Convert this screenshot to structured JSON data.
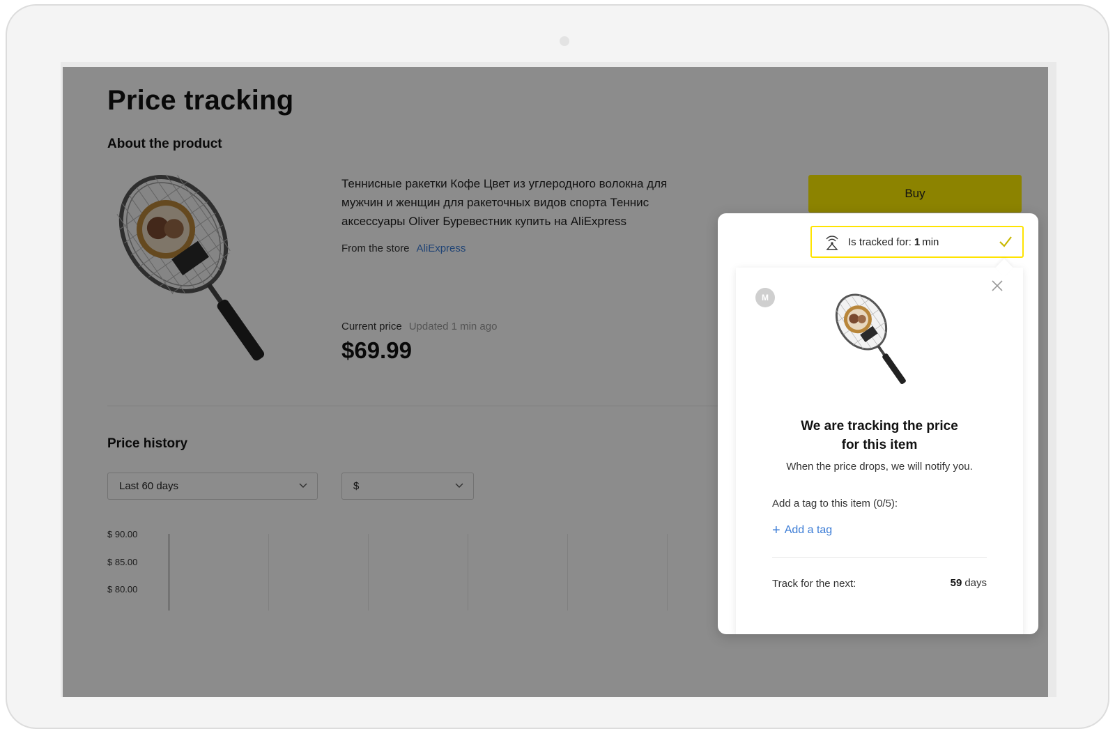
{
  "page": {
    "title": "Price tracking",
    "about_title": "About the product",
    "product_name": "Теннисные ракетки Кофе Цвет из углеродного волокна для мужчин и женщин для ракеточных видов спорта Теннис аксессуары Oliver Буревестник купить на AliExpress",
    "store_label": "From the store",
    "store_name": "AliExpress",
    "current_price_label": "Current price",
    "updated_text": "Updated 1 min ago",
    "current_price": "$69.99",
    "buy_label": "Buy",
    "price_history_title": "Price history",
    "period_select": "Last 60 days",
    "currency_select": "$",
    "y_ticks": [
      "$ 90.00",
      "$ 85.00",
      "$ 80.00"
    ]
  },
  "popup": {
    "tracked_prefix": "Is tracked for:",
    "tracked_value": "1",
    "tracked_unit": "min",
    "avatar_letter": "M",
    "title": "We are tracking the price for this item",
    "subtitle": "When the price drops, we will notify you.",
    "tag_label": "Add a tag to this item (0/5):",
    "add_tag_label": "Add a tag",
    "add_tag_symbol": "+",
    "track_label": "Track for the next:",
    "track_days_value": "59",
    "track_days_unit": "days"
  },
  "colors": {
    "accent_yellow": "#ffee00",
    "link_blue": "#3a7bd5",
    "overlay": "rgba(0,0,0,0.45)"
  },
  "icons": {
    "radar": "radar-icon",
    "check": "check-icon",
    "close": "close-icon",
    "chevron": "chevron-down-icon",
    "racket": "tennis-racket-image"
  }
}
